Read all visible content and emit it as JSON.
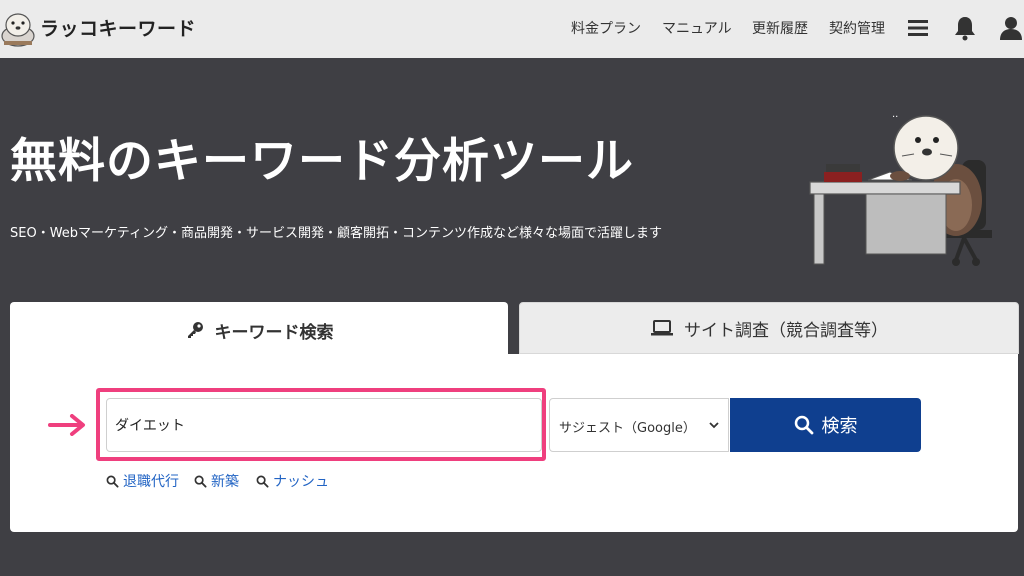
{
  "header": {
    "logo_text": "ラッコキーワード",
    "nav": [
      "料金プラン",
      "マニュアル",
      "更新履歴",
      "契約管理"
    ],
    "icons": [
      "menu-icon",
      "bell-icon",
      "user-icon"
    ]
  },
  "hero": {
    "title": "無料のキーワード分析ツール",
    "subtitle": "SEO・Webマーケティング・商品開発・サービス開発・顧客開拓・コンテンツ作成など様々な場面で活躍します"
  },
  "tabs": {
    "keyword": {
      "label": "キーワード検索",
      "icon": "key-icon"
    },
    "site": {
      "label": "サイト調査（競合調査等）",
      "icon": "laptop-icon"
    }
  },
  "search": {
    "value": "ダイエット",
    "select_value": "サジェスト（Google）",
    "button_label": "検索",
    "suggestions": [
      "退職代行",
      "新築",
      "ナッシュ"
    ]
  },
  "colors": {
    "background": "#3f3f44",
    "highlight": "#ef3f7e",
    "primary": "#0f3f8f",
    "link": "#2264c4"
  }
}
